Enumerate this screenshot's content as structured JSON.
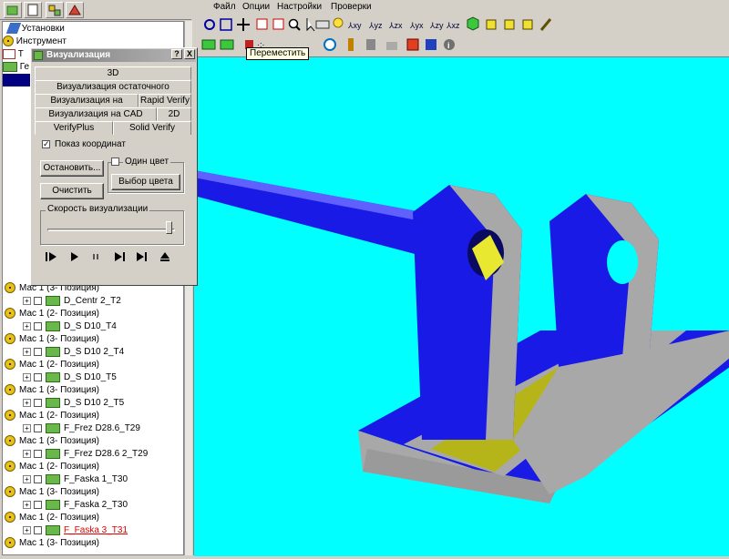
{
  "menu": [
    "Файл",
    "Опции",
    "Настройки",
    "Проверки"
  ],
  "tooltip": "Переместить",
  "tree_top": {
    "item0": "Установки",
    "item1": "Инструмент",
    "item2": "Т",
    "item3": "Ге"
  },
  "tree": [
    {
      "kind": "op",
      "label": "Мас 1 (3- Позиция)"
    },
    {
      "kind": "tool",
      "label": "D_Centr 2_T2"
    },
    {
      "kind": "op",
      "label": "Мас 1 (2- Позиция)"
    },
    {
      "kind": "tool",
      "label": "D_S D10_T4"
    },
    {
      "kind": "op",
      "label": "Мас 1 (3- Позиция)"
    },
    {
      "kind": "tool",
      "label": "D_S D10 2_T4"
    },
    {
      "kind": "op",
      "label": "Мас 1 (2- Позиция)"
    },
    {
      "kind": "tool",
      "label": "D_S D10_T5"
    },
    {
      "kind": "op",
      "label": "Мас 1 (3- Позиция)"
    },
    {
      "kind": "tool",
      "label": "D_S D10 2_T5"
    },
    {
      "kind": "op",
      "label": "Мас 1 (2- Позиция)"
    },
    {
      "kind": "tool",
      "label": "F_Frez D28.6_T29"
    },
    {
      "kind": "op",
      "label": "Мас 1 (3- Позиция)"
    },
    {
      "kind": "tool",
      "label": "F_Frez D28.6 2_T29"
    },
    {
      "kind": "op",
      "label": "Мас 1 (2- Позиция)"
    },
    {
      "kind": "tool",
      "label": "F_Faska 1_T30"
    },
    {
      "kind": "op",
      "label": "Мас 1 (3- Позиция)"
    },
    {
      "kind": "tool",
      "label": "F_Faska 2_T30"
    },
    {
      "kind": "op",
      "label": "Мас 1 (2- Позиция)"
    },
    {
      "kind": "tool-red",
      "label": "F_Faska 3_T31"
    },
    {
      "kind": "op",
      "label": "Мас 1 (3- Позиция)"
    }
  ],
  "dialog": {
    "title": "Визуализация",
    "help": "?",
    "close": "X",
    "tabs_row1": [
      "3D"
    ],
    "tabs_row2": [
      "Визуализация остаточного материала"
    ],
    "tabs_row3": [
      "Визуализация на станке",
      "Rapid Verify"
    ],
    "tabs_row4": [
      "Визуализация на CAD Модели",
      "2D"
    ],
    "tabs_row5": [
      "VerifyPlus",
      "Solid Verify"
    ],
    "show_coords": "Показ координат",
    "stop_btn": "Остановить...",
    "clear_btn": "Очистить",
    "one_color": "Один цвет",
    "color_btn": "Выбор цвета",
    "speed_label": "Скорость визуализации"
  },
  "colors": {
    "viewport_bg": "#00ffff",
    "part_blue": "#1a1ae6",
    "part_gray": "#a8a8a8",
    "part_olive": "#b5b51a"
  }
}
